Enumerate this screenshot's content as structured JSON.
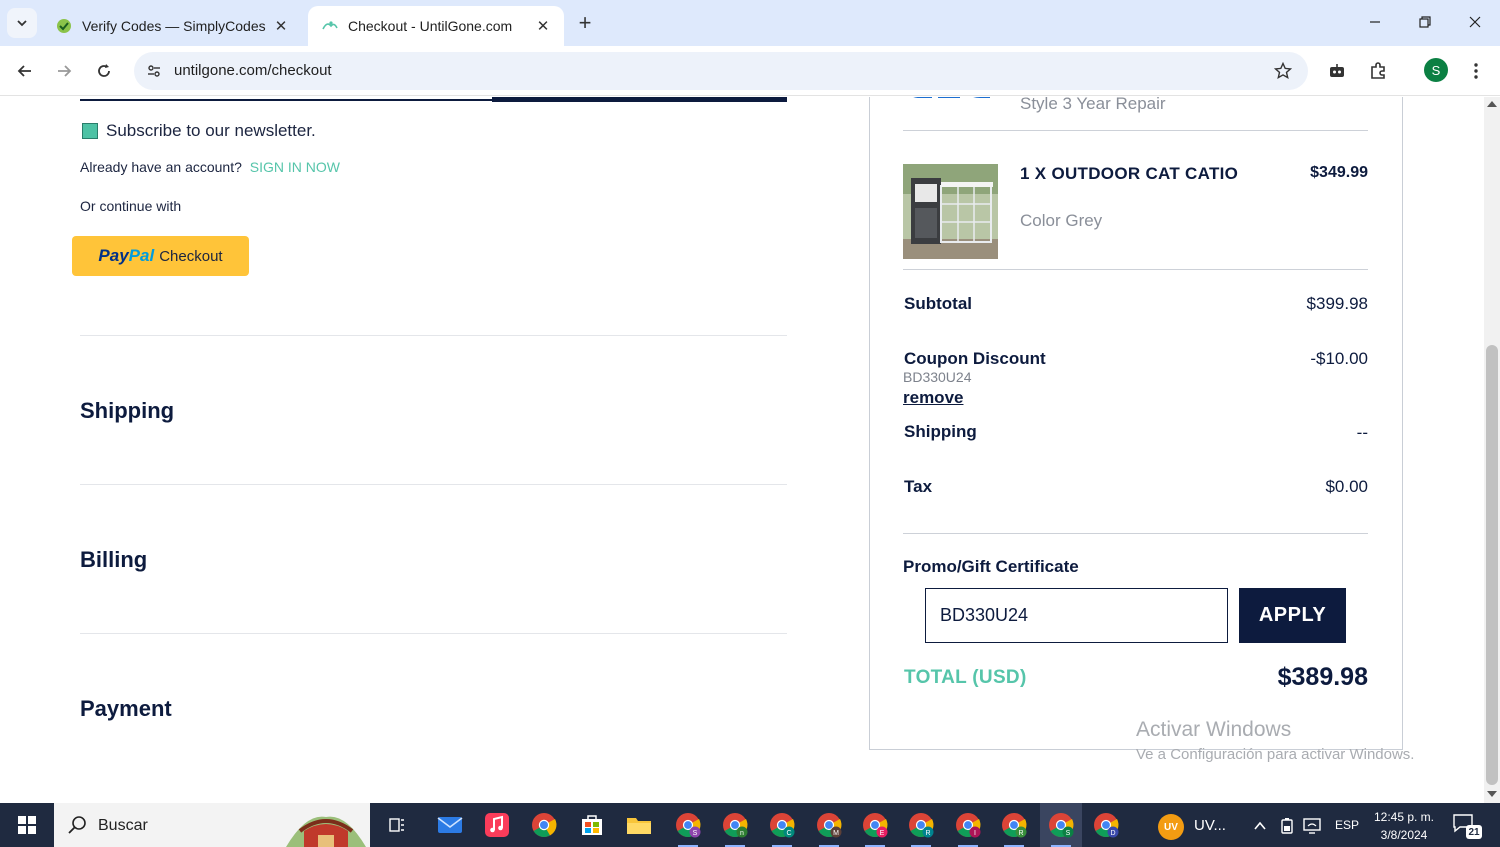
{
  "browser": {
    "tabs": [
      {
        "title": "Verify Codes — SimplyCodes",
        "active": false
      },
      {
        "title": "Checkout - UntilGone.com",
        "active": true
      }
    ],
    "url": "untilgone.com/checkout",
    "profile_initial": "S"
  },
  "checkout": {
    "newsletter_label": "Subscribe to our newsletter.",
    "have_account_text": "Already have an account?",
    "sign_in_link": "SIGN IN NOW",
    "continue_with": "Or continue with",
    "paypal": {
      "pay": "Pay",
      "pal": "Pal",
      "checkout": "Checkout"
    },
    "sections": [
      "Shipping",
      "Billing",
      "Payment"
    ]
  },
  "summary": {
    "prev_item_detail": "Style 3 Year Repair",
    "item": {
      "name": "1 X OUTDOOR CAT CATIO",
      "price": "$349.99",
      "color": "Color Grey"
    },
    "subtotal": {
      "label": "Subtotal",
      "value": "$399.98"
    },
    "coupon": {
      "label": "Coupon Discount",
      "value": "-$10.00",
      "code": "BD330U24",
      "remove": "remove"
    },
    "shipping": {
      "label": "Shipping",
      "value": "--"
    },
    "tax": {
      "label": "Tax",
      "value": "$0.00"
    },
    "promo_label": "Promo/Gift Certificate",
    "promo_value": "BD330U24",
    "apply_label": "APPLY",
    "total": {
      "label": "TOTAL (USD)",
      "value": "$389.98"
    }
  },
  "watermark": {
    "line1": "Activar Windows",
    "line2": "Ve a Configuración para activar Windows."
  },
  "taskbar": {
    "search_placeholder": "Buscar",
    "uv_badge": "UV",
    "uv_text": "UV...",
    "language": "ESP",
    "time": "12:45 p. m.",
    "date": "3/8/2024",
    "notifications": "21",
    "chrome_profiles": [
      "S",
      "n",
      "C",
      "M",
      "E",
      "R",
      "I",
      "R",
      "S",
      "D"
    ]
  },
  "colors": {
    "navy": "#0d1b3e",
    "accent_teal": "#56c5aa",
    "paypal_yellow": "#ffc439",
    "taskbar": "#1f2a40"
  }
}
